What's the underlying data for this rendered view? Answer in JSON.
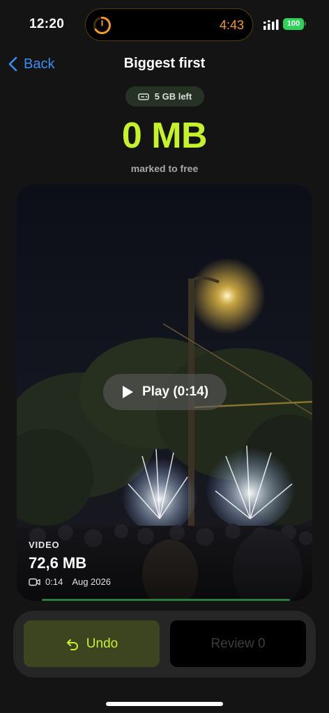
{
  "status_bar": {
    "time": "12:20",
    "island_timer": "4:43",
    "battery": "100",
    "timer_color": "#f39a1e",
    "battery_color": "#2fd158"
  },
  "nav": {
    "back_label": "Back",
    "title": "Biggest first",
    "back_icon": "chevron-left-icon"
  },
  "storage": {
    "left_label": "5 GB left",
    "icon": "drive-icon"
  },
  "freed": {
    "amount": "0 MB",
    "caption": "marked to free",
    "accent": "#c6f22a"
  },
  "media": {
    "play_label": "Play (0:14)",
    "type": "VIDEO",
    "size": "72,6 MB",
    "duration": "0:14",
    "date": "Aug 2026"
  },
  "actions": {
    "undo_label": "Undo",
    "review_label": "Review 0"
  }
}
